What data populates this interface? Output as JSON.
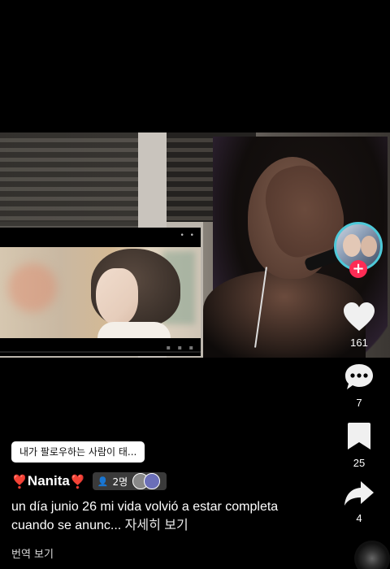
{
  "follow_chip": {
    "label": "내가 팔로우하는 사람이 태..."
  },
  "author": {
    "name": "Nanita",
    "prefix_emoji": "❣️",
    "suffix_emoji": "❣️",
    "friends_count": "2명"
  },
  "caption": {
    "text": "un día  junio 26 mi vida volvió a estar completa cuando se anunc...",
    "see_more": "자세히 보기"
  },
  "translate": {
    "label": "번역 보기"
  },
  "rail": {
    "likes": "161",
    "comments": "7",
    "saves": "25",
    "shares": "4"
  },
  "icons": {
    "avatar": "creator-avatar",
    "follow": "plus-icon",
    "like": "heart-icon",
    "comment": "comment-bubble-icon",
    "save": "bookmark-icon",
    "share": "share-arrow-icon",
    "sound": "music-disc-icon"
  },
  "colors": {
    "accent_follow": "#fe2c55",
    "avatar_ring": "#4ec9d9",
    "background": "#000000"
  }
}
